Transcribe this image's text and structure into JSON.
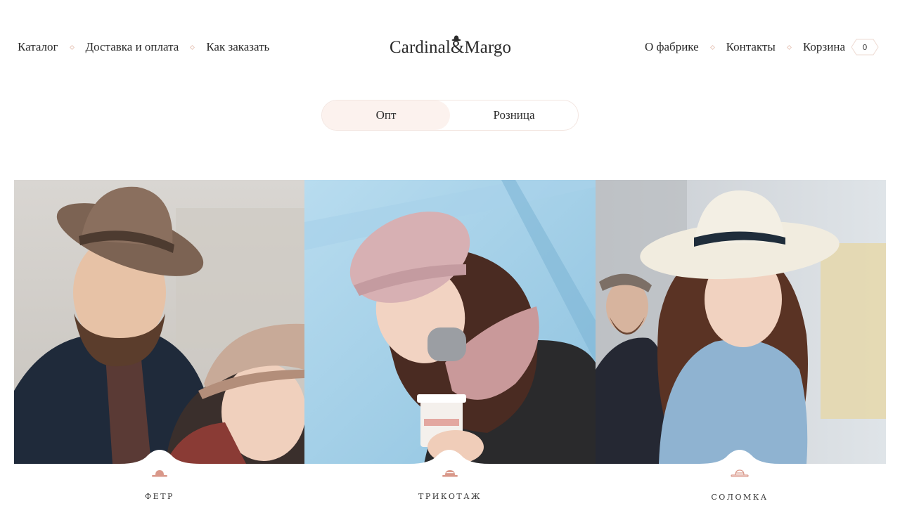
{
  "header": {
    "nav_left": [
      "Каталог",
      "Доставка и оплата",
      "Как заказать"
    ],
    "logo": "Cardinal&Margo",
    "nav_right": [
      "О фабрике",
      "Контакты",
      "Корзина"
    ],
    "cart_count": "0"
  },
  "toggle": {
    "options": [
      "Опт",
      "Розница"
    ],
    "active": "Опт"
  },
  "categories": [
    {
      "label": "ФЕТР"
    },
    {
      "label": "ТРИКОТАЖ"
    },
    {
      "label": "СОЛОМКА"
    }
  ],
  "colors": {
    "accent": "#e9c9bd",
    "toggle_active": "#fcf2ee",
    "icon": "#d9988a"
  }
}
